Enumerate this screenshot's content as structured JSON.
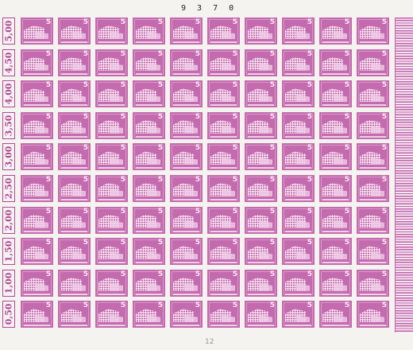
{
  "sheet": {
    "sheet_number": "9 3 7 0",
    "corner_mark": "12",
    "stamp_color": "#c46aae",
    "margin_color": "#b04a95",
    "rows": 10,
    "columns": 10,
    "denomination": "5",
    "counters": [
      "5,00",
      "4,50",
      "4,00",
      "3,50",
      "3,00",
      "2,50",
      "2,00",
      "1,50",
      "1,00",
      "0,50"
    ]
  }
}
